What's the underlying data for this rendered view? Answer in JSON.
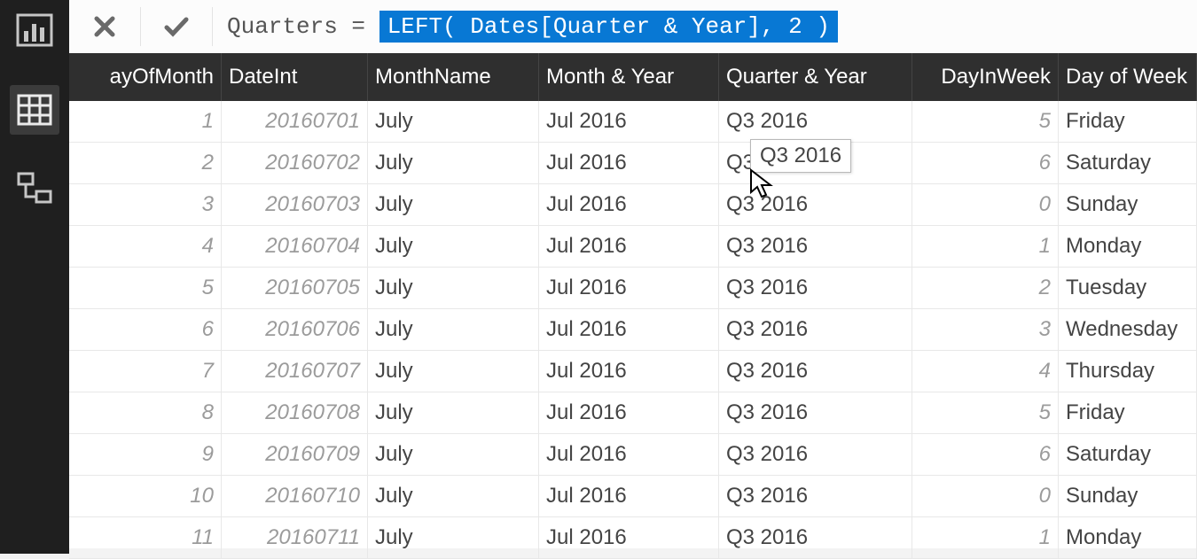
{
  "nav": {
    "items": [
      {
        "name": "report-icon"
      },
      {
        "name": "data-icon",
        "active": true
      },
      {
        "name": "model-icon"
      }
    ]
  },
  "formula": {
    "prefix": "Quarters =",
    "expr": "LEFT( Dates[Quarter & Year], 2 )",
    "highlight_color": "#0878d4"
  },
  "tooltip": "Q3 2016",
  "columns": [
    {
      "key": "dayofmonth",
      "label": "ayOfMonth",
      "align": "right"
    },
    {
      "key": "dateint",
      "label": "DateInt",
      "align": "right"
    },
    {
      "key": "monthname",
      "label": "MonthName",
      "align": "left"
    },
    {
      "key": "monthyear",
      "label": "Month & Year",
      "align": "left"
    },
    {
      "key": "quarteryear",
      "label": "Quarter & Year",
      "align": "left"
    },
    {
      "key": "dayinweek",
      "label": "DayInWeek",
      "align": "right"
    },
    {
      "key": "dow",
      "label": "Day of Week",
      "align": "left"
    }
  ],
  "rows": [
    {
      "dayofmonth": "1",
      "dateint": "20160701",
      "monthname": "July",
      "monthyear": "Jul 2016",
      "quarteryear": "Q3 2016",
      "dayinweek": "5",
      "dow": "Friday"
    },
    {
      "dayofmonth": "2",
      "dateint": "20160702",
      "monthname": "July",
      "monthyear": "Jul 2016",
      "quarteryear": "Q3 2016",
      "dayinweek": "6",
      "dow": "Saturday"
    },
    {
      "dayofmonth": "3",
      "dateint": "20160703",
      "monthname": "July",
      "monthyear": "Jul 2016",
      "quarteryear": "Q3 2016",
      "dayinweek": "0",
      "dow": "Sunday"
    },
    {
      "dayofmonth": "4",
      "dateint": "20160704",
      "monthname": "July",
      "monthyear": "Jul 2016",
      "quarteryear": "Q3 2016",
      "dayinweek": "1",
      "dow": "Monday"
    },
    {
      "dayofmonth": "5",
      "dateint": "20160705",
      "monthname": "July",
      "monthyear": "Jul 2016",
      "quarteryear": "Q3 2016",
      "dayinweek": "2",
      "dow": "Tuesday"
    },
    {
      "dayofmonth": "6",
      "dateint": "20160706",
      "monthname": "July",
      "monthyear": "Jul 2016",
      "quarteryear": "Q3 2016",
      "dayinweek": "3",
      "dow": "Wednesday"
    },
    {
      "dayofmonth": "7",
      "dateint": "20160707",
      "monthname": "July",
      "monthyear": "Jul 2016",
      "quarteryear": "Q3 2016",
      "dayinweek": "4",
      "dow": "Thursday"
    },
    {
      "dayofmonth": "8",
      "dateint": "20160708",
      "monthname": "July",
      "monthyear": "Jul 2016",
      "quarteryear": "Q3 2016",
      "dayinweek": "5",
      "dow": "Friday"
    },
    {
      "dayofmonth": "9",
      "dateint": "20160709",
      "monthname": "July",
      "monthyear": "Jul 2016",
      "quarteryear": "Q3 2016",
      "dayinweek": "6",
      "dow": "Saturday"
    },
    {
      "dayofmonth": "10",
      "dateint": "20160710",
      "monthname": "July",
      "monthyear": "Jul 2016",
      "quarteryear": "Q3 2016",
      "dayinweek": "0",
      "dow": "Sunday"
    },
    {
      "dayofmonth": "11",
      "dateint": "20160711",
      "monthname": "July",
      "monthyear": "Jul 2016",
      "quarteryear": "Q3 2016",
      "dayinweek": "1",
      "dow": "Monday"
    }
  ]
}
